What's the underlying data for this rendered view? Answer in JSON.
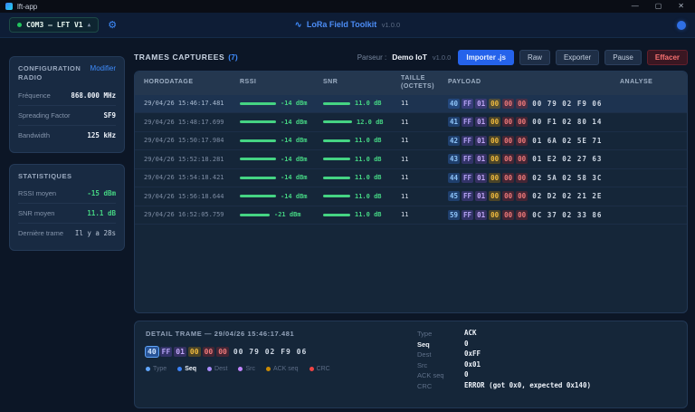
{
  "window": {
    "title": "lft-app",
    "controls": {
      "minimize": "—",
      "maximize": "▢",
      "close": "✕"
    }
  },
  "header": {
    "port_chip": "COM3 — LFT V1",
    "port_caret": "▲",
    "wave_icon": "∿",
    "app_title": "LoRa Field Toolkit",
    "version": "v1.0.0"
  },
  "sidebar": {
    "config": {
      "title": "CONFIGURATION RADIO",
      "action": "Modifier",
      "rows": [
        {
          "label": "Fréquence",
          "value": "868.000 MHz",
          "style": "white"
        },
        {
          "label": "Spreading Factor",
          "value": "SF9",
          "style": "white"
        },
        {
          "label": "Bandwidth",
          "value": "125 kHz",
          "style": "white"
        }
      ]
    },
    "stats": {
      "title": "STATISTIQUES",
      "rows": [
        {
          "label": "RSSI moyen",
          "value": "-15 dBm",
          "style": "green"
        },
        {
          "label": "SNR moyen",
          "value": "11.1 dB",
          "style": "green"
        },
        {
          "label": "Dernière trame",
          "value": "Il y a 28s",
          "style": "dim"
        }
      ]
    }
  },
  "captures": {
    "title": "TRAMES CAPTUREES",
    "count": "(7)",
    "parser_label": "Parseur :",
    "parser_name": "Demo IoT",
    "parser_version": "v1.0.0",
    "buttons": {
      "import": "Importer .js",
      "raw": "Raw",
      "export": "Exporter",
      "pause": "Pause",
      "clear": "Effacer"
    },
    "columns": [
      "HORODATAGE",
      "RSSI",
      "SNR",
      "TAILLE (OCTETS)",
      "PAYLOAD",
      "ANALYSE"
    ],
    "rows": [
      {
        "timestamp": "29/04/26 15:46:17.481",
        "rssi_dbm": -14,
        "rssi_text": "-14 dBm",
        "snr_db": 11.0,
        "snr_text": "11.0 dB",
        "size": "11",
        "header_bytes": [
          "40",
          "FF",
          "01",
          "00",
          "00",
          "00"
        ],
        "data_bytes": "00 79 02 F9 06",
        "selected": true
      },
      {
        "timestamp": "29/04/26 15:48:17.699",
        "rssi_dbm": -14,
        "rssi_text": "-14 dBm",
        "snr_db": 12.0,
        "snr_text": "12.0 dB",
        "size": "11",
        "header_bytes": [
          "41",
          "FF",
          "01",
          "00",
          "00",
          "00"
        ],
        "data_bytes": "00 F1 02 80 14",
        "selected": false
      },
      {
        "timestamp": "29/04/26 15:50:17.984",
        "rssi_dbm": -14,
        "rssi_text": "-14 dBm",
        "snr_db": 11.0,
        "snr_text": "11.0 dB",
        "size": "11",
        "header_bytes": [
          "42",
          "FF",
          "01",
          "00",
          "00",
          "00"
        ],
        "data_bytes": "01 6A 02 5E 71",
        "selected": false
      },
      {
        "timestamp": "29/04/26 15:52:18.281",
        "rssi_dbm": -14,
        "rssi_text": "-14 dBm",
        "snr_db": 11.0,
        "snr_text": "11.0 dB",
        "size": "11",
        "header_bytes": [
          "43",
          "FF",
          "01",
          "00",
          "00",
          "00"
        ],
        "data_bytes": "01 E2 02 27 63",
        "selected": false
      },
      {
        "timestamp": "29/04/26 15:54:18.421",
        "rssi_dbm": -14,
        "rssi_text": "-14 dBm",
        "snr_db": 11.0,
        "snr_text": "11.0 dB",
        "size": "11",
        "header_bytes": [
          "44",
          "FF",
          "01",
          "00",
          "00",
          "00"
        ],
        "data_bytes": "02 5A 02 58 3C",
        "selected": false
      },
      {
        "timestamp": "29/04/26 15:56:18.644",
        "rssi_dbm": -14,
        "rssi_text": "-14 dBm",
        "snr_db": 11.0,
        "snr_text": "11.0 dB",
        "size": "11",
        "header_bytes": [
          "45",
          "FF",
          "01",
          "00",
          "00",
          "00"
        ],
        "data_bytes": "02 D2 02 21 2E",
        "selected": false
      },
      {
        "timestamp": "29/04/26 16:52:05.759",
        "rssi_dbm": -21,
        "rssi_text": "-21 dBm",
        "snr_db": 11.0,
        "snr_text": "11.0 dB",
        "size": "11",
        "header_bytes": [
          "59",
          "FF",
          "01",
          "00",
          "00",
          "00"
        ],
        "data_bytes": "0C 37 02 33 86",
        "selected": false
      }
    ]
  },
  "detail": {
    "title": "DETAIL TRAME — 29/04/26 15:46:17.481",
    "header_bytes": [
      "40",
      "FF",
      "01",
      "00",
      "00",
      "00"
    ],
    "data_bytes": "00 79 02 F9 06",
    "highlighted_byte_index": 0,
    "legend": [
      {
        "label": "Type",
        "color": "#60a5fa",
        "active": false
      },
      {
        "label": "Seq",
        "color": "#3b82f6",
        "active": true
      },
      {
        "label": "Dest",
        "color": "#a78bfa",
        "active": false
      },
      {
        "label": "Src",
        "color": "#c084fc",
        "active": false
      },
      {
        "label": "ACK seq",
        "color": "#ca8a04",
        "active": false
      },
      {
        "label": "CRC",
        "color": "#ef4444",
        "active": false
      }
    ],
    "fields": [
      {
        "label": "Type",
        "value": "ACK",
        "active": false
      },
      {
        "label": "Seq",
        "value": "0",
        "active": true
      },
      {
        "label": "Dest",
        "value": "0xFF",
        "active": false
      },
      {
        "label": "Src",
        "value": "0x01",
        "active": false
      },
      {
        "label": "ACK seq",
        "value": "0",
        "active": false
      },
      {
        "label": "CRC",
        "value": "ERROR (got 0x0, expected 0x140)",
        "active": false
      }
    ]
  },
  "colors": {
    "accent_blue": "#3f8cfd",
    "signal_green": "#45d483",
    "danger_red": "#f87171",
    "byte_type": "#8fc5f9",
    "byte_dest": "#b6a3f6",
    "byte_src": "#c3a9f9",
    "byte_ack": "#f1bb3e",
    "byte_crc": "#ef7a7a"
  }
}
